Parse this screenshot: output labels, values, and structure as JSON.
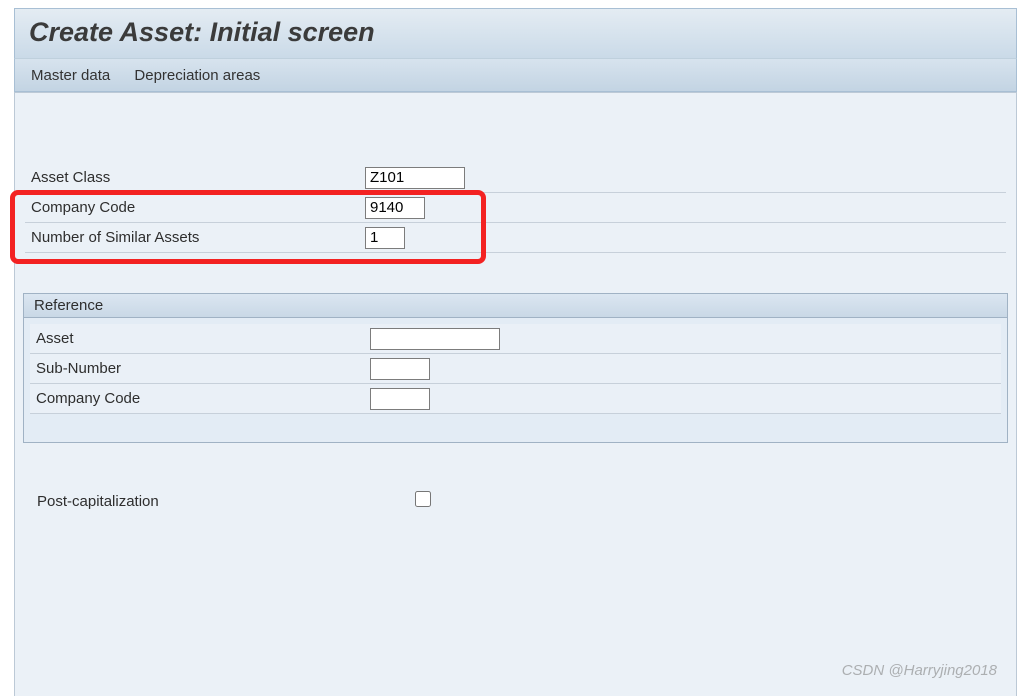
{
  "title": "Create Asset:  Initial screen",
  "menu": {
    "master_data": "Master data",
    "depreciation_areas": "Depreciation areas"
  },
  "fields": {
    "asset_class": {
      "label": "Asset Class",
      "value": "Z101"
    },
    "company_code": {
      "label": "Company Code",
      "value": "9140"
    },
    "num_similar": {
      "label": "Number of Similar Assets",
      "value": "1"
    }
  },
  "reference": {
    "group_title": "Reference",
    "asset": {
      "label": "Asset",
      "value": ""
    },
    "sub_number": {
      "label": "Sub-Number",
      "value": ""
    },
    "company_code": {
      "label": "Company Code",
      "value": ""
    }
  },
  "post_capitalization": {
    "label": "Post-capitalization",
    "checked": false
  },
  "watermark": "CSDN @Harryjing2018"
}
